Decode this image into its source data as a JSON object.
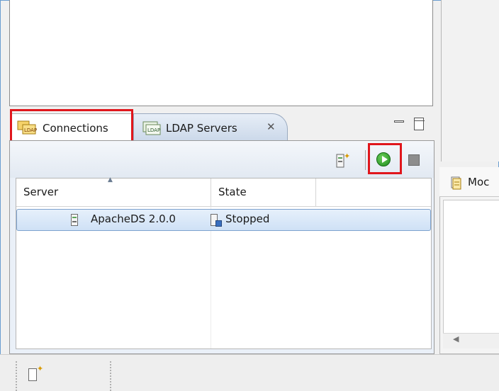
{
  "tabs": {
    "connections_label": "Connections",
    "ldap_servers_label": "LDAP Servers",
    "close_glyph": "✕"
  },
  "right_panel": {
    "tab_label": "Moc"
  },
  "table": {
    "columns": [
      "Server",
      "State"
    ],
    "rows": [
      {
        "server": "ApacheDS 2.0.0",
        "state": "Stopped"
      }
    ]
  },
  "icons": {
    "connections": "connections-icon",
    "ldap_servers": "ldap-servers-icon",
    "new_server": "new-server-icon",
    "start": "start-server-icon",
    "stop": "stop-server-icon",
    "server": "server-icon",
    "state_stopped": "stopped-state-icon",
    "new_bottom": "new-item-icon"
  },
  "colors": {
    "highlight": "#e0161c",
    "start_green": "#1c8a1c",
    "selection_border": "#7da2ce"
  }
}
